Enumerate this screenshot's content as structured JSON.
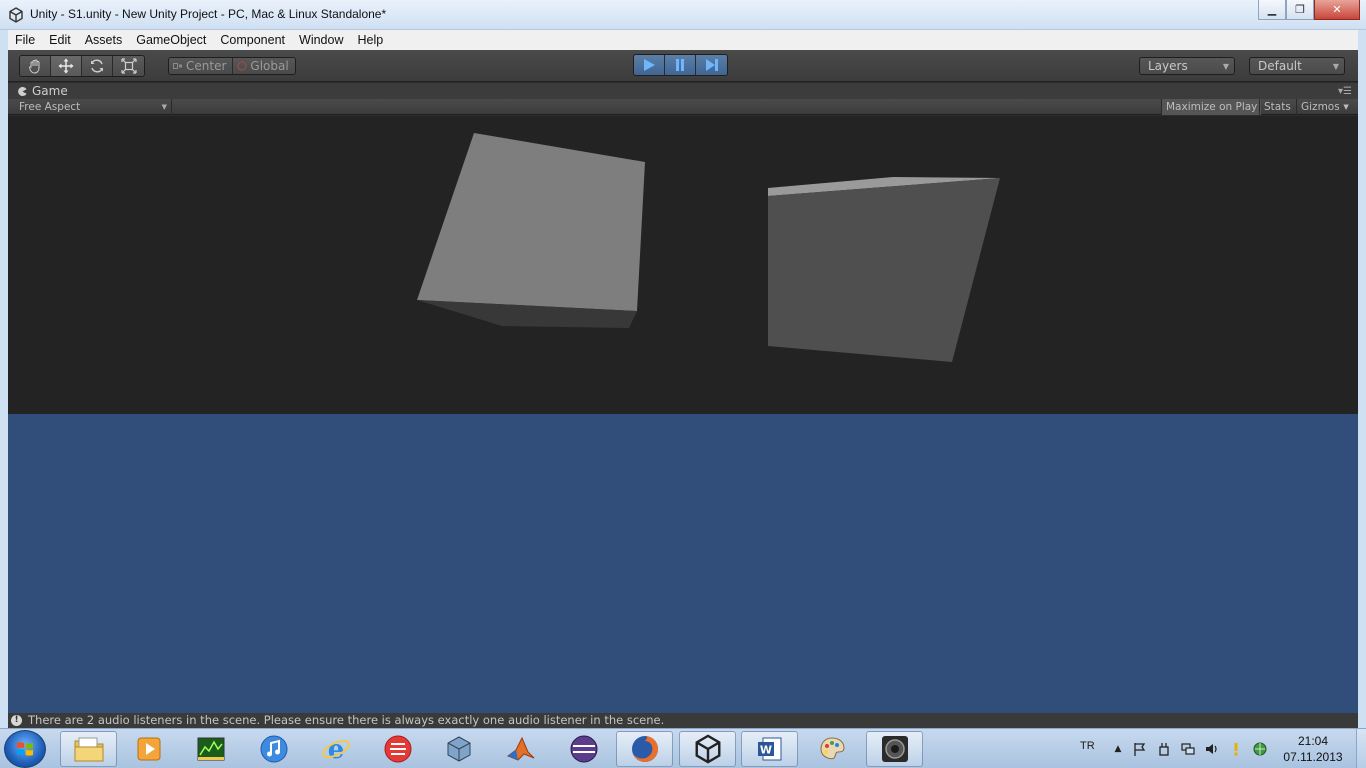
{
  "window": {
    "title": "Unity - S1.unity - New Unity Project - PC, Mac & Linux Standalone*",
    "minimize": "▁",
    "maximize": "❐",
    "close": "✕"
  },
  "menu": {
    "items": [
      "File",
      "Edit",
      "Assets",
      "GameObject",
      "Component",
      "Window",
      "Help"
    ]
  },
  "toolbar": {
    "pivot_mode": "Center",
    "pivot_rotation": "Global",
    "layers": "Layers",
    "layout": "Default"
  },
  "game_panel": {
    "tab_label": "Game",
    "aspect": "Free Aspect",
    "maximize_on_play": "Maximize on Play",
    "stats": "Stats",
    "gizmos": "Gizmos"
  },
  "status": {
    "message": "There are 2 audio listeners in the scene. Please ensure there is always exactly one audio listener in the scene."
  },
  "taskbar": {
    "language": "TR",
    "time": "21:04",
    "date": "07.11.2013"
  },
  "colors": {
    "sky": "#232323",
    "ground": "#314d79",
    "accent_play": "#3f6591"
  }
}
